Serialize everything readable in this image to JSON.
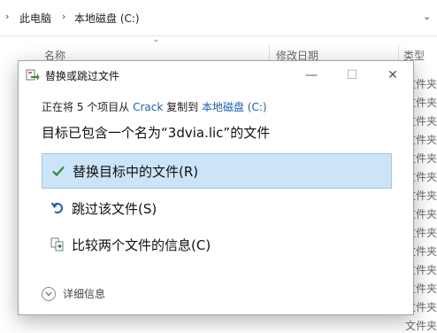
{
  "explorer": {
    "breadcrumb": [
      "此电脑",
      "本地磁盘 (C:)"
    ],
    "columns": {
      "name": "名称",
      "modified": "修改日期",
      "type": "类型"
    },
    "type_cells": [
      "文件夹",
      "文件夹",
      "文件夹",
      "文件夹",
      "文件夹",
      "文件夹",
      "文件夹",
      "文件夹",
      "文件夹",
      "文件夹",
      "文件夹",
      "文件夹",
      "文件夹",
      "文件夹"
    ]
  },
  "dialog": {
    "title": "替换或跳过文件",
    "controls": {
      "minimize": "—",
      "maximize": "☐",
      "close": "✕"
    },
    "copy_line": {
      "prefix": "正在将 5 个项目从",
      "source": "Crack",
      "middle": "复制到",
      "destination": "本地磁盘 (C:)"
    },
    "conflict_message": "目标已包含一个名为“3dvia.lic”的文件",
    "options": {
      "replace": "替换目标中的文件(R)",
      "skip": "跳过该文件(S)",
      "compare": "比较两个文件的信息(C)"
    },
    "details_label": "详细信息",
    "colors": {
      "selected_bg": "#cce4f7",
      "selected_border": "#99c9ef",
      "link": "#1a5fb4",
      "check": "#2e8b3a"
    }
  }
}
